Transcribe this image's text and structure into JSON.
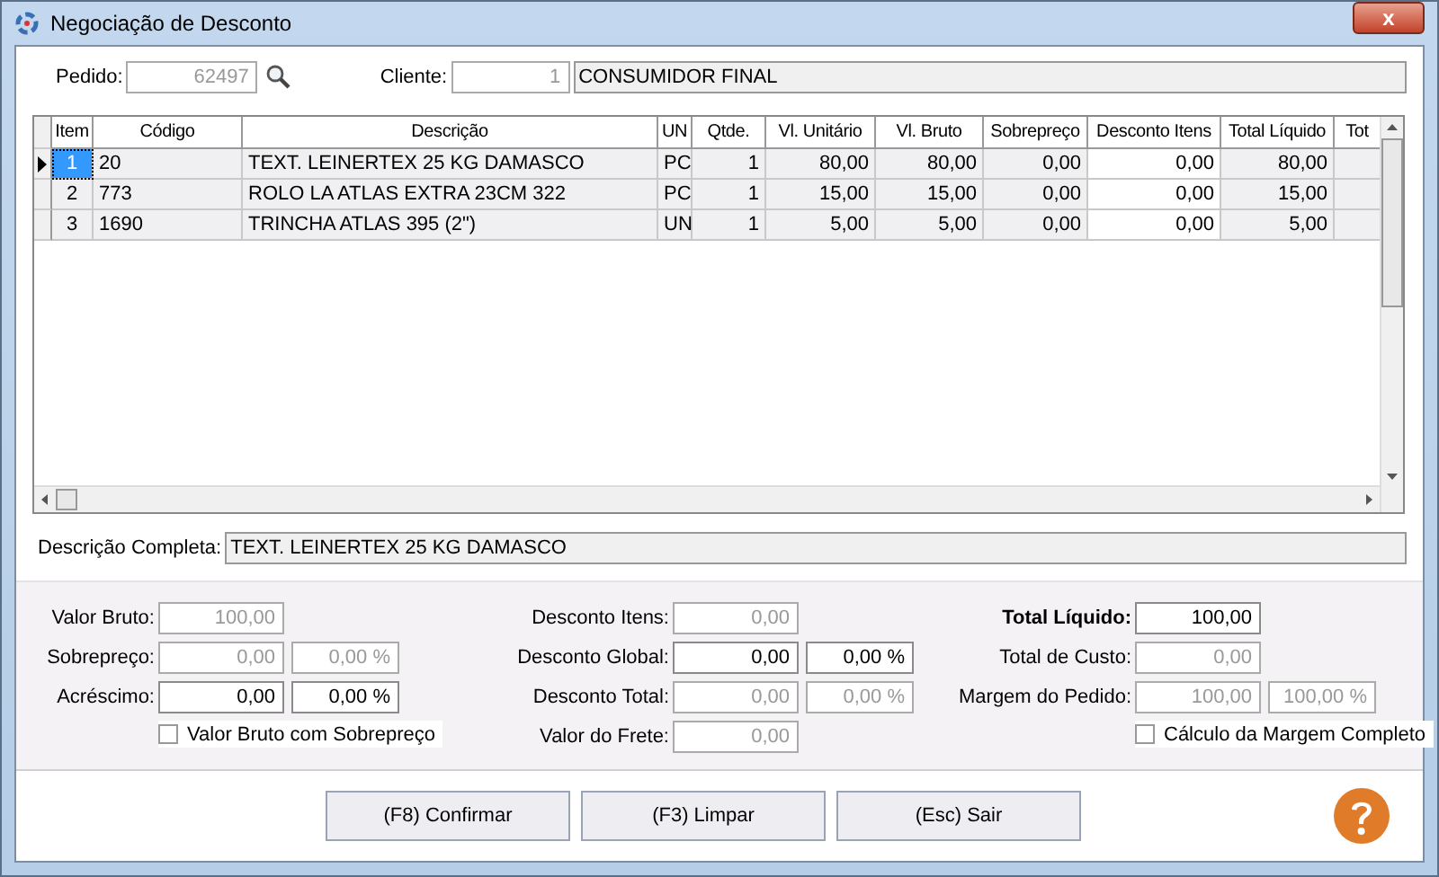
{
  "window": {
    "title": "Negociação de Desconto",
    "close": "x"
  },
  "pedido": {
    "label": "Pedido:",
    "value": "62497",
    "disabled": true
  },
  "cliente": {
    "label": "Cliente:",
    "code": "1",
    "name": "CONSUMIDOR FINAL",
    "disabled": true
  },
  "table": {
    "columns": [
      {
        "label": "Item",
        "editable": false
      },
      {
        "label": "Código",
        "editable": false
      },
      {
        "label": "Descrição",
        "editable": false
      },
      {
        "label": "UN",
        "editable": false
      },
      {
        "label": "Qtde.",
        "editable": false
      },
      {
        "label": "Vl. Unitário",
        "editable": false
      },
      {
        "label": "Vl. Bruto",
        "editable": false
      },
      {
        "label": "Sobrepreço",
        "editable": false
      },
      {
        "label": "Desconto Itens",
        "editable": true
      },
      {
        "label": "Total Líquido",
        "editable": false
      },
      {
        "label": "Tot",
        "editable": false
      }
    ],
    "rows": [
      {
        "selected": true,
        "cells": [
          "1",
          "20",
          "TEXT. LEINERTEX 25 KG DAMASCO",
          "PC",
          "1",
          "80,00",
          "80,00",
          "0,00",
          "0,00",
          "80,00",
          ""
        ]
      },
      {
        "selected": false,
        "cells": [
          "2",
          "773",
          "ROLO LA ATLAS EXTRA 23CM 322",
          "PC",
          "1",
          "15,00",
          "15,00",
          "0,00",
          "0,00",
          "15,00",
          ""
        ]
      },
      {
        "selected": false,
        "cells": [
          "3",
          "1690",
          "TRINCHA ATLAS 395 (2\")",
          "UN",
          "1",
          "5,00",
          "5,00",
          "0,00",
          "0,00",
          "5,00",
          ""
        ]
      }
    ]
  },
  "descricao_completa": {
    "label": "Descrição Completa:",
    "value": "TEXT. LEINERTEX 25 KG DAMASCO"
  },
  "summary": [
    {
      "kind": "fields",
      "rows": [
        {
          "label": "Valor Bruto:",
          "bold": false,
          "fields": [
            {
              "value": "100,00",
              "disabled": true
            }
          ]
        },
        {
          "label": "Sobrepreço:",
          "bold": false,
          "fields": [
            {
              "value": "0,00",
              "disabled": true
            },
            {
              "value": "0,00 %",
              "disabled": true
            }
          ]
        },
        {
          "label": "Acréscimo:",
          "bold": false,
          "fields": [
            {
              "value": "0,00",
              "disabled": false
            },
            {
              "value": "0,00 %",
              "disabled": false
            }
          ]
        }
      ],
      "checkbox": {
        "label": "Valor Bruto com Sobrepreço",
        "checked": false
      }
    },
    {
      "kind": "fields",
      "rows": [
        {
          "label": "Desconto Itens:",
          "bold": false,
          "fields": [
            {
              "value": "0,00",
              "disabled": true
            }
          ]
        },
        {
          "label": "Desconto Global:",
          "bold": false,
          "fields": [
            {
              "value": "0,00",
              "disabled": false
            },
            {
              "value": "0,00 %",
              "disabled": false
            }
          ]
        },
        {
          "label": "Desconto Total:",
          "bold": false,
          "fields": [
            {
              "value": "0,00",
              "disabled": true
            },
            {
              "value": "0,00 %",
              "disabled": true
            }
          ]
        },
        {
          "label": "Valor do Frete:",
          "bold": false,
          "fields": [
            {
              "value": "0,00",
              "disabled": true
            }
          ]
        }
      ]
    },
    {
      "kind": "fields",
      "rows": [
        {
          "label": "Total Líquido:",
          "bold": true,
          "fields": [
            {
              "value": "100,00",
              "disabled": false
            }
          ]
        },
        {
          "label": "Total de Custo:",
          "bold": false,
          "fields": [
            {
              "value": "0,00",
              "disabled": true
            }
          ]
        },
        {
          "label": "Margem do Pedido:",
          "bold": false,
          "fields": [
            {
              "value": "100,00",
              "disabled": true
            },
            {
              "value": "100,00 %",
              "disabled": true
            }
          ]
        }
      ],
      "checkbox": {
        "label": "Cálculo da Margem Completo",
        "checked": false
      }
    }
  ],
  "buttons": [
    "(F8) Confirmar",
    "(F3) Limpar",
    "(Esc) Sair"
  ]
}
